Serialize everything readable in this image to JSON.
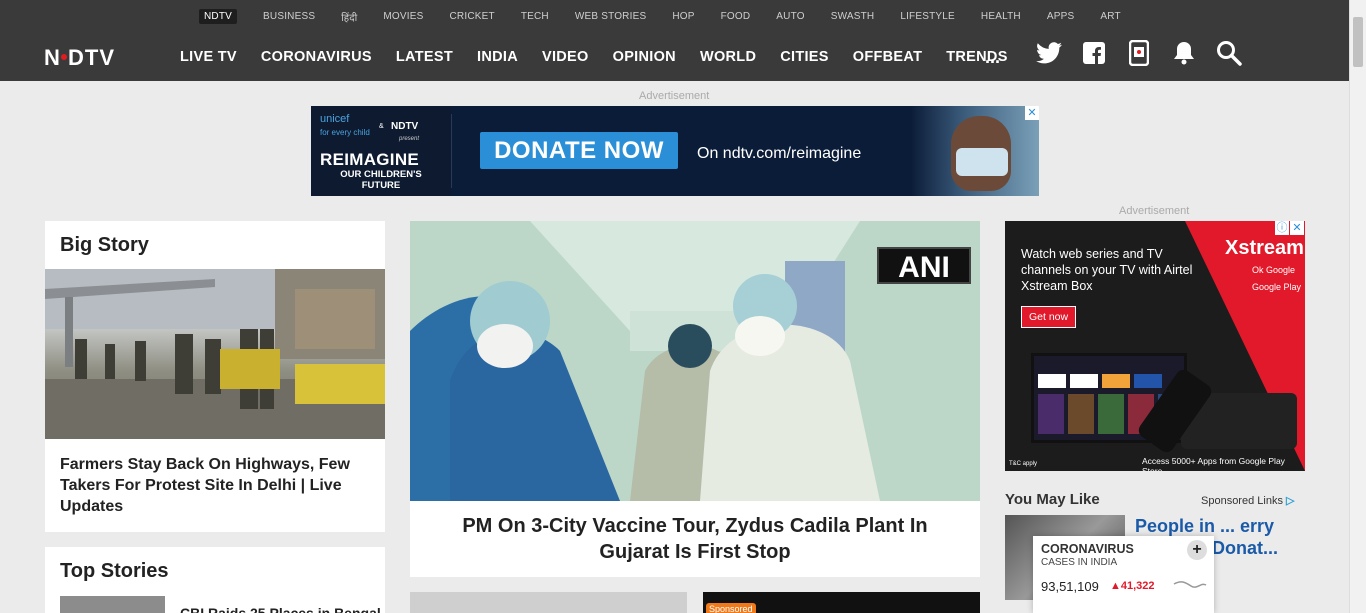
{
  "topnav": [
    "NDTV",
    "BUSINESS",
    "हिंदी",
    "MOVIES",
    "CRICKET",
    "TECH",
    "WEB STORIES",
    "HOP",
    "FOOD",
    "AUTO",
    "SWASTH",
    "LIFESTYLE",
    "HEALTH",
    "APPS",
    "ART"
  ],
  "logo": "NDTV",
  "mainnav": [
    "LIVE TV",
    "CORONAVIRUS",
    "LATEST",
    "INDIA",
    "VIDEO",
    "OPINION",
    "WORLD",
    "CITIES",
    "OFFBEAT",
    "TRENDS"
  ],
  "more": "...",
  "header_icons": [
    "twitter-icon",
    "facebook-icon",
    "mobile-app-icon",
    "bell-icon",
    "search-icon"
  ],
  "advertisement_label": "Advertisement",
  "top_ad": {
    "unicef": "unicef",
    "for_every_child": "for every child",
    "amp": "&",
    "ndtv": "NDTV",
    "present": "present",
    "reimagine": "REIMAGINE",
    "our_children": "OUR CHILDREN'S FUTURE",
    "donate": "DONATE NOW",
    "url": "On ndtv.com/reimagine"
  },
  "big_story": {
    "title": "Big Story",
    "headline": "Farmers Stay Back On Highways, Few Takers For Protest Site In Delhi | Live Updates"
  },
  "top_stories": {
    "title": "Top Stories",
    "first_item": "CBI Raids 25 Places in Bengal"
  },
  "hero": {
    "badge": "ANI",
    "headline": "PM On 3-City Vaccine Tour, Zydus Cadila Plant In Gujarat Is First Stop"
  },
  "sponsored_tag": "Sponsored",
  "right_ad": {
    "watch": "Watch web series and TV channels on your TV with Airtel Xstream Box",
    "get_now": "Get now",
    "brand": "Xstream",
    "ok_google": "Ok Google",
    "google_play": "Google Play",
    "access": "Access 5000+ Apps from Google Play Store",
    "tc": "T&C apply"
  },
  "you_may_like": {
    "title": "You May Like",
    "sponsored_links": "Sponsored Links",
    "headline": "People in ... erry Are ... to Donat..."
  },
  "corona_widget": {
    "title": "CORONAVIRUS",
    "subtitle": "CASES IN INDIA",
    "cases": "93,51,109",
    "delta": "41,322",
    "plus": "+"
  },
  "colors": {
    "header_bg": "#3a3a3a",
    "ndtv_red": "#e21b22",
    "donate_blue": "#2a8fd6",
    "airtel_red": "#e1192a",
    "link_blue": "#1a5aa8"
  }
}
